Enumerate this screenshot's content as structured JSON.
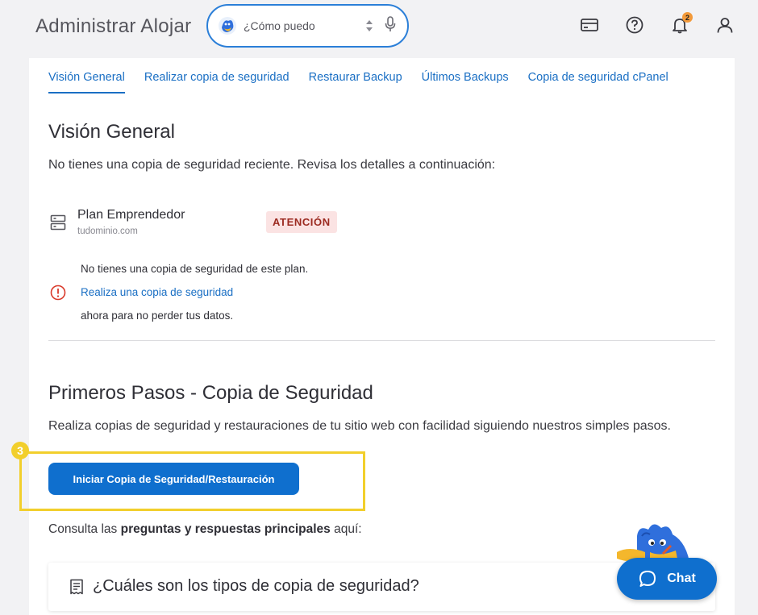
{
  "header": {
    "title": "Administrar Alojar",
    "search": {
      "placeholder": "¿Cómo puedo"
    },
    "notifications_count": "2"
  },
  "tabs": [
    {
      "label": "Visión General",
      "active": true
    },
    {
      "label": "Realizar copia de seguridad",
      "active": false
    },
    {
      "label": "Restaurar Backup",
      "active": false
    },
    {
      "label": "Últimos Backups",
      "active": false
    },
    {
      "label": "Copia de seguridad cPanel",
      "active": false
    }
  ],
  "overview": {
    "title": "Visión General",
    "subtitle": "No tienes una copia de seguridad reciente. Revisa los detalles a continuación:",
    "plan": {
      "name": "Plan Emprendedor",
      "domain": "tudominio.com",
      "status_badge": "ATENCIÓN"
    },
    "alert": {
      "line1": "No tienes una copia de seguridad de este plan.",
      "link": "Realiza una copia de seguridad",
      "line3": "ahora para no perder tus datos."
    }
  },
  "getting_started": {
    "title": "Primeros Pasos - Copia de Seguridad",
    "description": "Realiza copias de seguridad y restauraciones de tu sitio web con facilidad siguiendo nuestros simples pasos.",
    "step_number": "3",
    "button_label": "Iniciar Copia de Seguridad/Restauración",
    "consulta_prefix": "Consulta las",
    "consulta_bold": "preguntas y respuestas principales",
    "consulta_suffix": "aquí:"
  },
  "faq": {
    "question": "¿Cuáles son los tipos de copia de seguridad?"
  },
  "chat": {
    "label": "Chat"
  },
  "colors": {
    "accent": "#0f6fce",
    "link": "#1a6fc4",
    "highlight": "#f2cf2c",
    "badge_bg": "#fbe3e3",
    "badge_text": "#9c2a20",
    "alert": "#d93a2b"
  },
  "icons": {
    "header": [
      "billing-card-icon",
      "help-circle-icon",
      "bell-icon",
      "user-icon"
    ],
    "plan": "server-icon",
    "alert": "alert-circle-icon",
    "faq": "receipt-icon",
    "chat": "chat-bubble-icon"
  }
}
